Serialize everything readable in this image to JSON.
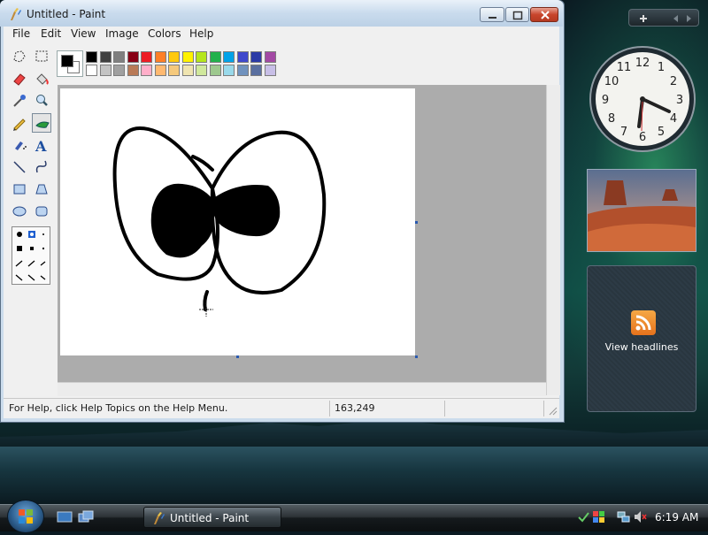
{
  "window": {
    "title": "Untitled - Paint"
  },
  "menu": [
    "File",
    "Edit",
    "View",
    "Image",
    "Colors",
    "Help"
  ],
  "status": {
    "help_text": "For Help, click Help Topics on the Help Menu.",
    "coords": "163,249"
  },
  "palette": {
    "row1": [
      "#000000",
      "#404040",
      "#7f7f7f",
      "#880015",
      "#ed1c24",
      "#ff7f27",
      "#ffc90e",
      "#fff200",
      "#b5e61d",
      "#22b14c",
      "#00a2e8",
      "#3f48cc",
      "#2b3aa6",
      "#a349a4"
    ],
    "row2": [
      "#ffffff",
      "#c3c3c3",
      "#a0a0a0",
      "#b97a57",
      "#ffaec9",
      "#ffb970",
      "#f5c97c",
      "#efe4b0",
      "#d0e89c",
      "#9dc88e",
      "#99d9ea",
      "#7092be",
      "#5a6fa0",
      "#c8bfe7"
    ],
    "foreground": "#000000",
    "background": "#ffffff"
  },
  "gadgets": {
    "feed_label": "View headlines"
  },
  "taskbar": {
    "task_label": "Untitled - Paint",
    "time": "6:19 AM"
  }
}
